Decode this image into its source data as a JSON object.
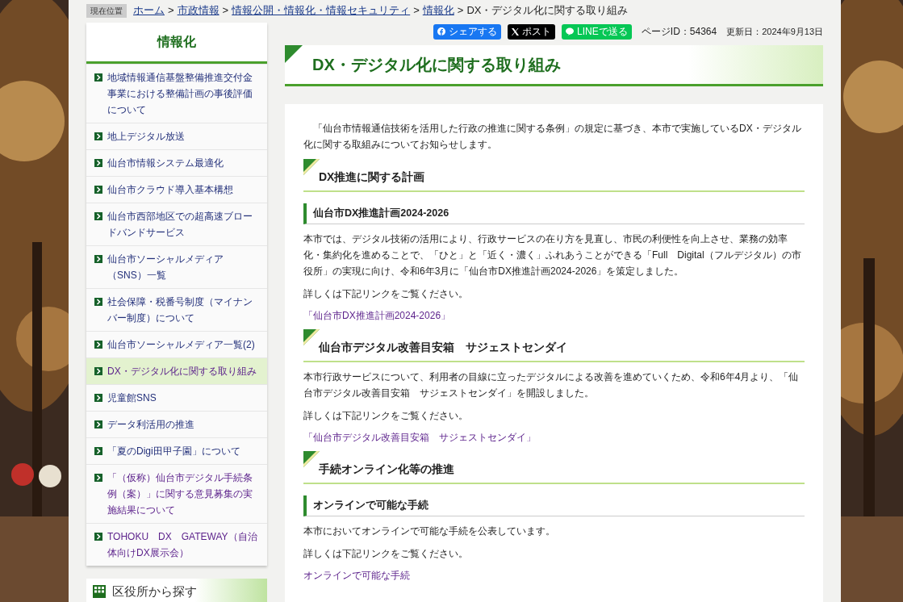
{
  "breadcrumb": {
    "label": "現在位置",
    "separator": ">",
    "items": [
      {
        "text": "ホーム",
        "kind": "link"
      },
      {
        "text": "市政情報",
        "kind": "link"
      },
      {
        "text": "情報公開・情報化・情報セキュリティ",
        "kind": "link"
      },
      {
        "text": "情報化",
        "kind": "link"
      },
      {
        "text": "DX・デジタル化に関する取り組み",
        "kind": "current"
      }
    ]
  },
  "share": [
    {
      "kind": "facebook",
      "label": "シェアする"
    },
    {
      "kind": "x",
      "label": "ポスト"
    },
    {
      "kind": "line",
      "label": "LINEで送る"
    }
  ],
  "page_id": "ページID：54364",
  "updated": "更新日：2024年9月13日",
  "sidebar": {
    "title": "情報化",
    "items": [
      {
        "label": "地域情報通信基盤整備推進交付金事業における整備計画の事後評価について",
        "selected": false,
        "visited": false
      },
      {
        "label": "地上デジタル放送",
        "selected": false,
        "visited": false
      },
      {
        "label": "仙台市情報システム最適化",
        "selected": false,
        "visited": false
      },
      {
        "label": "仙台市クラウド導入基本構想",
        "selected": false,
        "visited": false
      },
      {
        "label": "仙台市西部地区での超高速ブロードバンドサービス",
        "selected": false,
        "visited": false
      },
      {
        "label": "仙台市ソーシャルメディア（SNS）一覧",
        "selected": false,
        "visited": false
      },
      {
        "label": "社会保障・税番号制度（マイナンバー制度）について",
        "selected": false,
        "visited": false
      },
      {
        "label": "仙台市ソーシャルメディア一覧(2)",
        "selected": false,
        "visited": false
      },
      {
        "label": "DX・デジタル化に関する取り組み",
        "selected": true,
        "visited": true
      },
      {
        "label": "児童館SNS",
        "selected": false,
        "visited": false
      },
      {
        "label": "データ利活用の推進",
        "selected": false,
        "visited": false
      },
      {
        "label": "「夏のDigi田甲子園」について",
        "selected": false,
        "visited": false
      },
      {
        "label": "「（仮称）仙台市デジタル手続条例（案）」に関する意見募集の実施結果について",
        "selected": false,
        "visited": true
      },
      {
        "label": "TOHOKU　DX　GATEWAY（自治体向けDX展示会）",
        "selected": false,
        "visited": true
      }
    ]
  },
  "sidebar2": {
    "title": "区役所から探す"
  },
  "main": {
    "title": "DX・デジタル化に関する取り組み",
    "blocks": [
      {
        "kind": "intro",
        "text": "「仙台市情報通信技術を活用した行政の推進に関する条例」の規定に基づき、本市で実施しているDX・デジタル化に関する取組みについてお知らせします。"
      },
      {
        "kind": "h2",
        "text": "DX推進に関する計画"
      },
      {
        "kind": "h3",
        "text": "仙台市DX推進計画2024-2026"
      },
      {
        "kind": "p",
        "text": "本市では、デジタル技術の活用により、行政サービスの在り方を見直し、市民の利便性を向上させ、業務の効率化・集約化を進めることで、「ひと」と「近く・濃く」ふれあうことができる「Full　Digital（フルデジタル）の市役所」の実現に向け、令和6年3月に「仙台市DX推進計画2024-2026」を策定しました。"
      },
      {
        "kind": "p",
        "text": "詳しくは下記リンクをご覧ください。"
      },
      {
        "kind": "link",
        "text": "「仙台市DX推進計画2024-2026」"
      },
      {
        "kind": "h2",
        "text": "仙台市デジタル改善目安箱　サジェストセンダイ"
      },
      {
        "kind": "p",
        "text": "本市行政サービスについて、利用者の目線に立ったデジタルによる改善を進めていくため、令和6年4月より、「仙台市デジタル改善目安箱　サジェストセンダイ」を開設しました。"
      },
      {
        "kind": "p",
        "text": "詳しくは下記リンクをご覧ください。"
      },
      {
        "kind": "link",
        "text": "「仙台市デジタル改善目安箱　サジェストセンダイ」"
      },
      {
        "kind": "h2",
        "text": "手続オンライン化等の推進"
      },
      {
        "kind": "h3",
        "text": "オンラインで可能な手続"
      },
      {
        "kind": "p",
        "text": "本市においてオンラインで可能な手続を公表しています。"
      },
      {
        "kind": "p",
        "text": "詳しくは下記リンクをご覧ください。"
      },
      {
        "kind": "link",
        "text": "オンラインで可能な手続"
      }
    ]
  }
}
